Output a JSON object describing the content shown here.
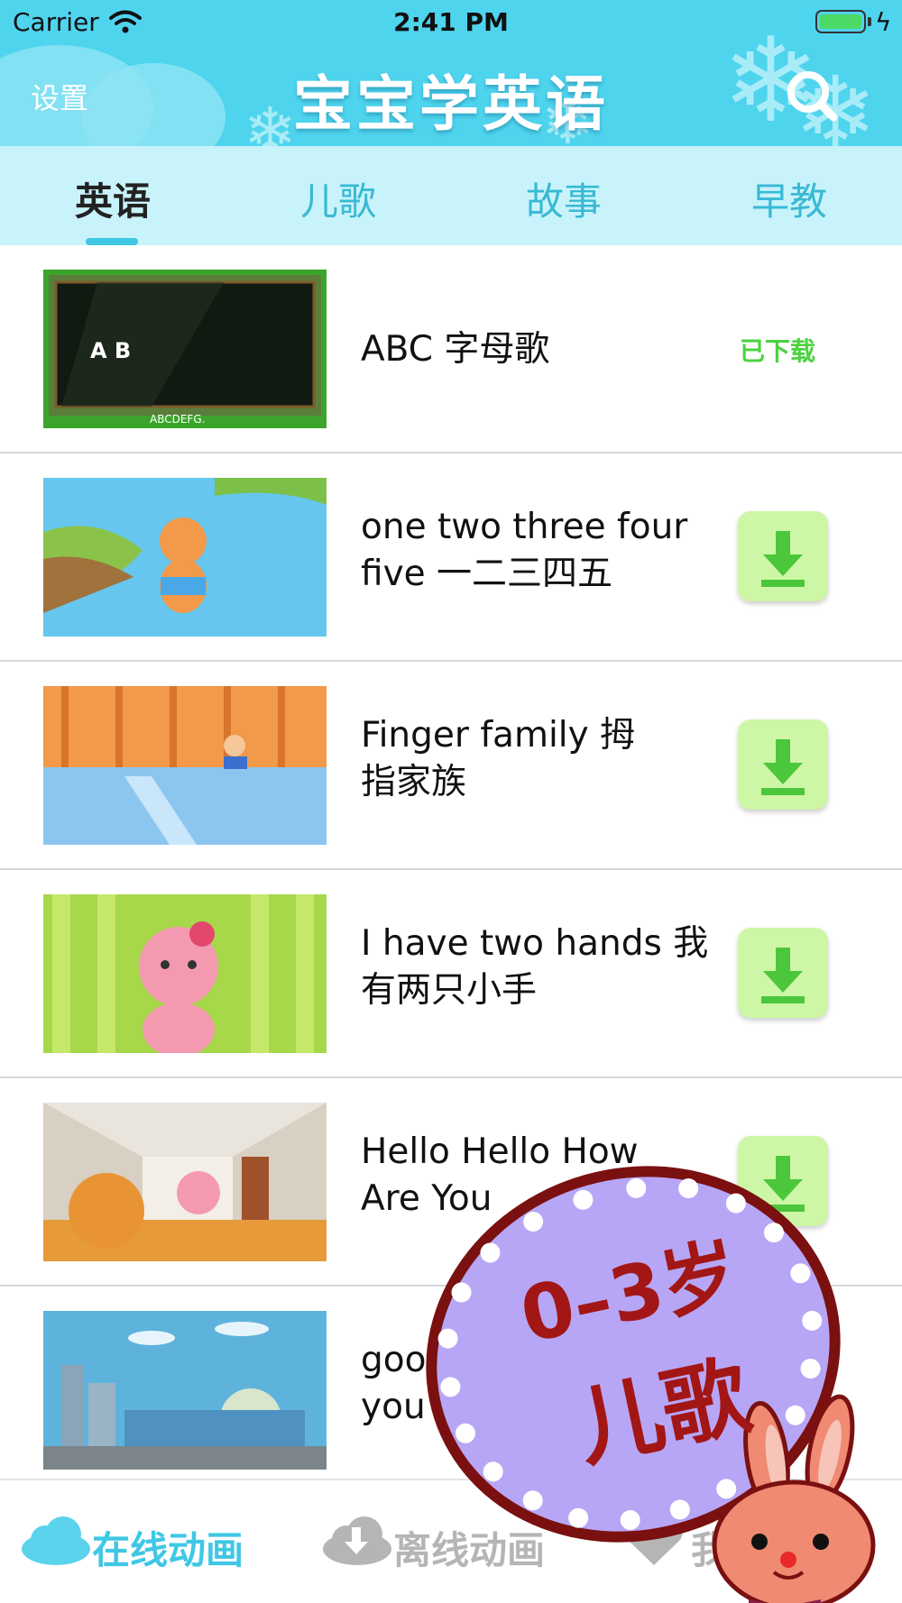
{
  "status_bar": {
    "carrier": "Carrier",
    "time": "2:41 PM",
    "wifi_icon": "wifi-icon",
    "battery_icon": "battery-icon",
    "charging_icon": "charging-bolt-icon"
  },
  "header": {
    "settings_label": "设置",
    "title": "宝宝学英语",
    "search_icon": "search-icon",
    "background_color": "#4fd4ee"
  },
  "tabs": {
    "items": [
      {
        "label": "英语",
        "active": true
      },
      {
        "label": "儿歌",
        "active": false
      },
      {
        "label": "故事",
        "active": false
      },
      {
        "label": "早教",
        "active": false
      }
    ],
    "active_color": "#222222",
    "inactive_color": "#39b9d4",
    "background_color": "#c8f3fb"
  },
  "videos": [
    {
      "title_line1": "ABC 字母歌",
      "title_line2": "",
      "thumbnail_caption": "A  B",
      "thumbnail_strip": "ABCDEFG.",
      "downloaded": true,
      "status": "已下载"
    },
    {
      "title_line1": "one two three four",
      "title_line2": "five 一二三四五",
      "downloaded": false,
      "action_icon": "download-icon"
    },
    {
      "title_line1": "Finger family 拇",
      "title_line2": "指家族",
      "downloaded": false,
      "action_icon": "download-icon"
    },
    {
      "title_line1": "I have two hands 我",
      "title_line2": "有两只小手",
      "downloaded": false,
      "action_icon": "download-icon"
    },
    {
      "title_line1": "Hello Hello How",
      "title_line2": "Are You",
      "downloaded": false,
      "action_icon": "download-icon"
    },
    {
      "title_line1": "goo",
      "title_line2": "you",
      "downloaded": false
    }
  ],
  "bottom_tabs": {
    "items": [
      {
        "label": "在线动画",
        "icon": "cloud-icon",
        "active": true
      },
      {
        "label": "离线动画",
        "icon": "cloud-download-icon",
        "active": false
      },
      {
        "label": "我",
        "icon": "heart-icon",
        "active": false
      }
    ],
    "active_color": "#3fc7e4",
    "inactive_color": "#b5b5b5"
  },
  "sticker": {
    "line1": "0–3岁",
    "line2": "儿歌",
    "icon": "bunny-icon",
    "badge_color": "#b7a6f5",
    "text_color": "#a31616"
  }
}
